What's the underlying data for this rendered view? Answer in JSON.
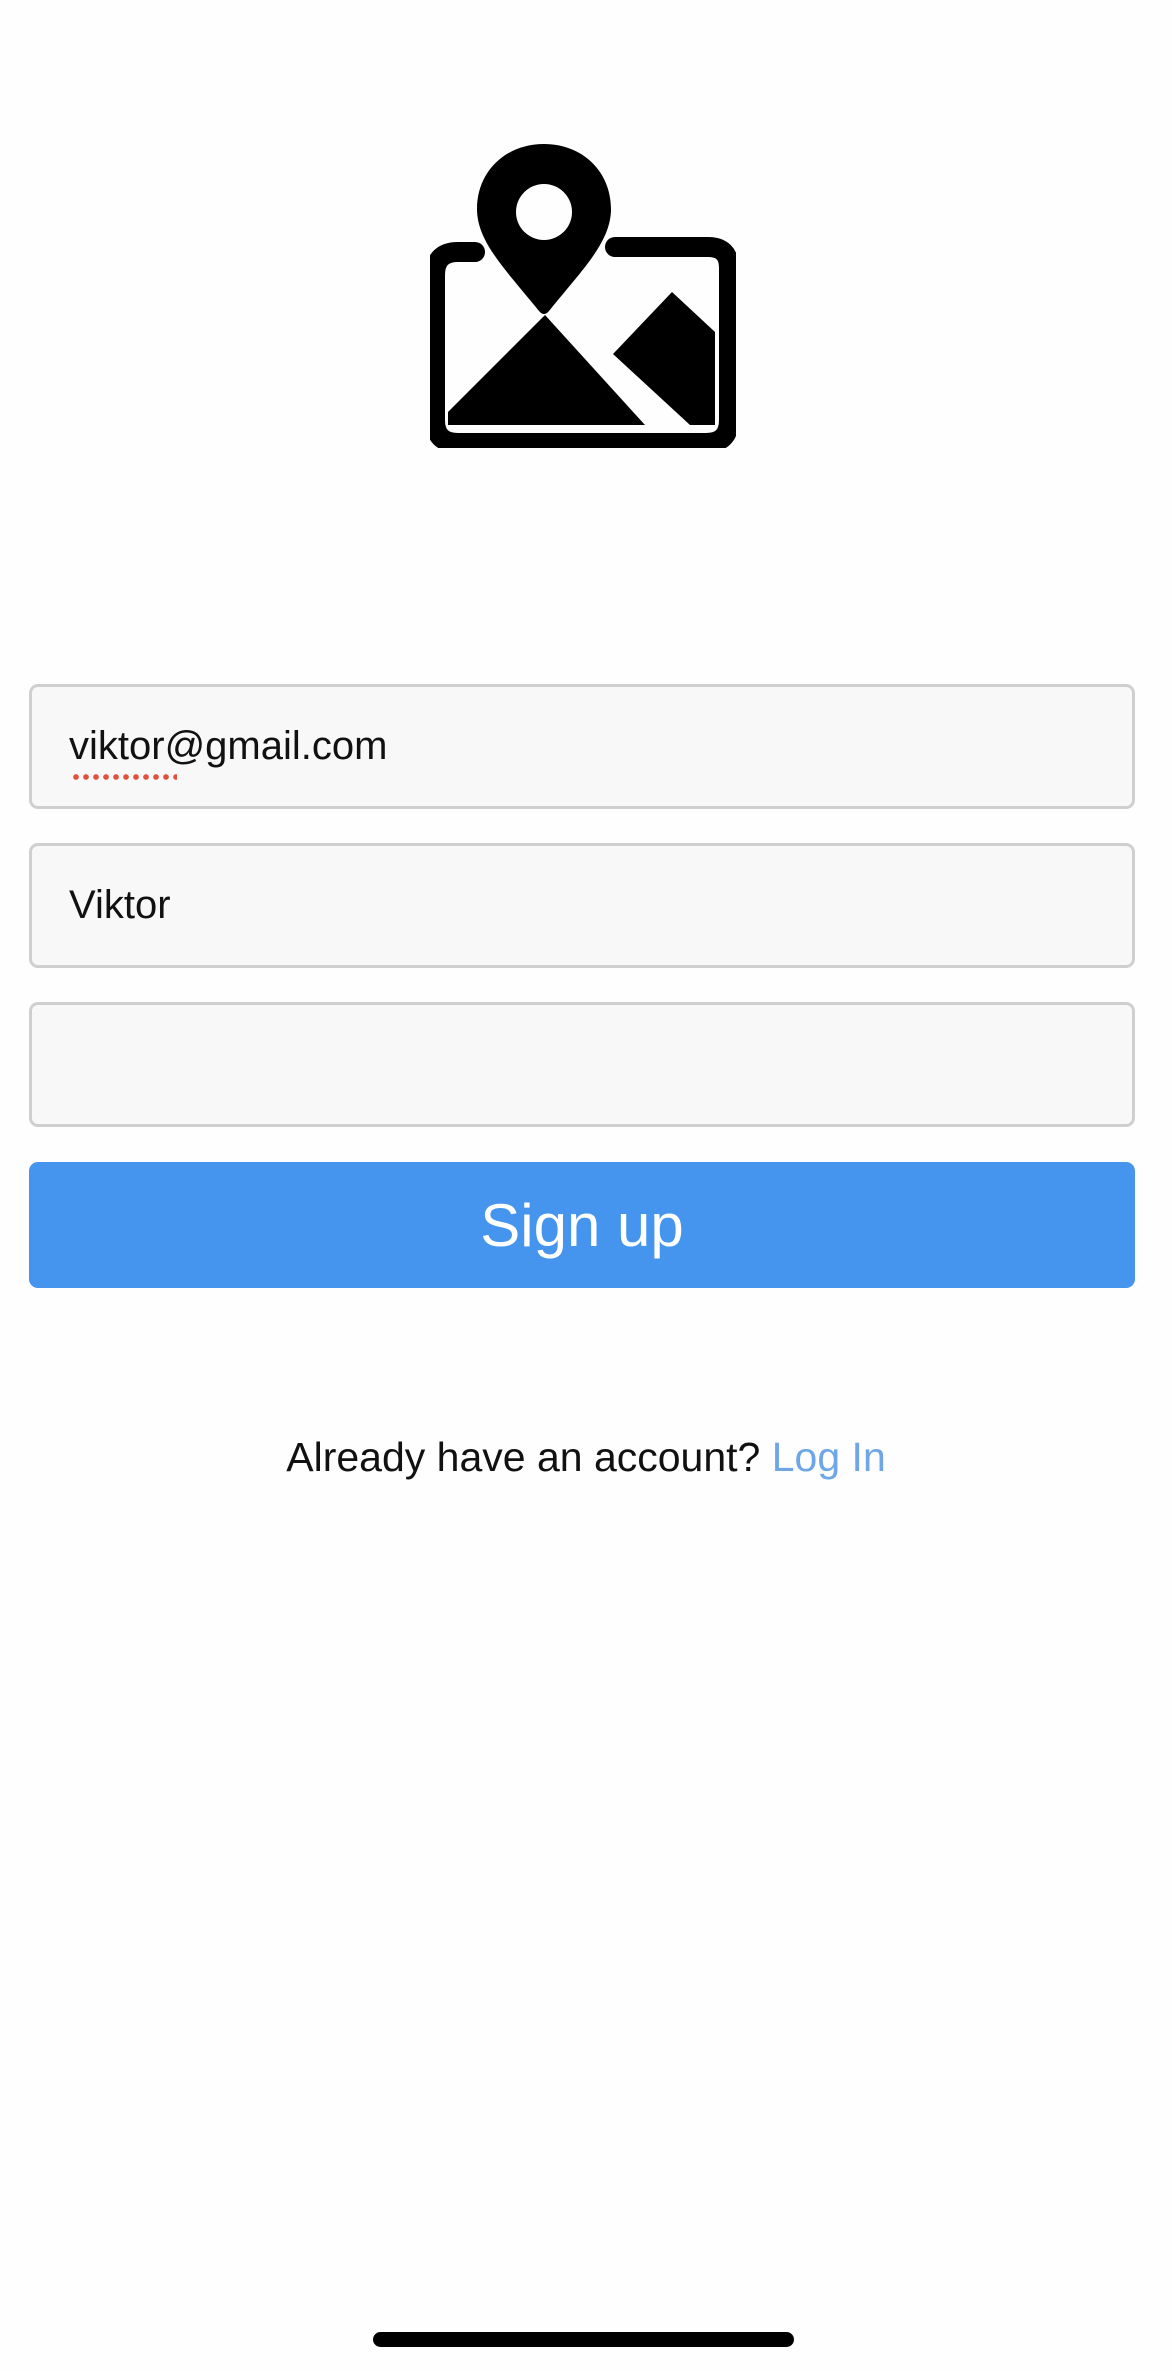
{
  "app": {
    "logo_icon": "map-pin-picture-icon"
  },
  "form": {
    "email_value": "viktor@gmail.com",
    "name_value": "Viktor",
    "password_value": ""
  },
  "signup_button": {
    "label": "Sign up",
    "color": "#4594ee"
  },
  "login_prompt": {
    "text": "Already have an account?",
    "link_label": "Log In",
    "link_color": "#6ea6e8"
  }
}
